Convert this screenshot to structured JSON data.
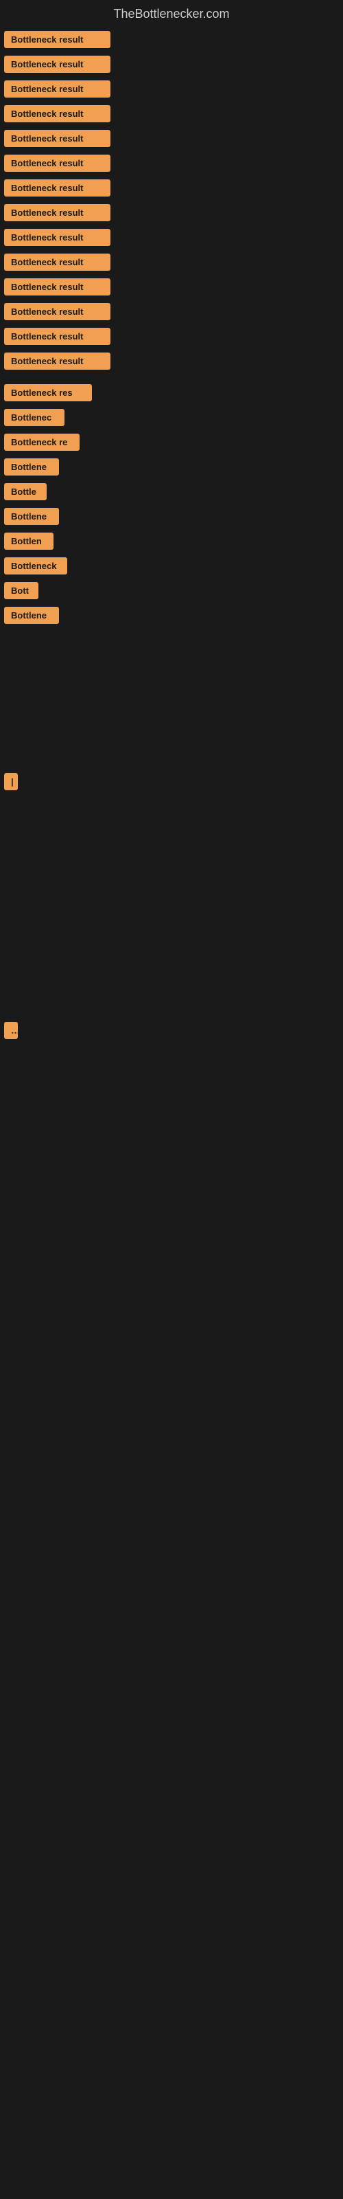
{
  "header": {
    "title": "TheBottlenecker.com"
  },
  "items": [
    {
      "label": "Bottleneck result",
      "width": 155
    },
    {
      "label": "Bottleneck result",
      "width": 155
    },
    {
      "label": "Bottleneck result",
      "width": 155
    },
    {
      "label": "Bottleneck result",
      "width": 155
    },
    {
      "label": "Bottleneck result",
      "width": 155
    },
    {
      "label": "Bottleneck result",
      "width": 155
    },
    {
      "label": "Bottleneck result",
      "width": 155
    },
    {
      "label": "Bottleneck result",
      "width": 155
    },
    {
      "label": "Bottleneck result",
      "width": 155
    },
    {
      "label": "Bottleneck result",
      "width": 155
    },
    {
      "label": "Bottleneck result",
      "width": 155
    },
    {
      "label": "Bottleneck result",
      "width": 155
    },
    {
      "label": "Bottleneck result",
      "width": 155
    },
    {
      "label": "Bottleneck result",
      "width": 155
    },
    {
      "label": "Bottleneck res",
      "width": 128
    },
    {
      "label": "Bottlenec",
      "width": 88
    },
    {
      "label": "Bottleneck re",
      "width": 110
    },
    {
      "label": "Bottlene",
      "width": 80
    },
    {
      "label": "Bottle",
      "width": 62
    },
    {
      "label": "Bottlene",
      "width": 80
    },
    {
      "label": "Bottlen",
      "width": 72
    },
    {
      "label": "Bottleneck",
      "width": 92
    },
    {
      "label": "Bott",
      "width": 50
    },
    {
      "label": "Bottlene",
      "width": 80
    }
  ],
  "trailing_items": [
    {
      "label": "|",
      "width": 10
    },
    {
      "label": "",
      "width": 0
    },
    {
      "label": "",
      "width": 0
    },
    {
      "label": "…",
      "width": 14
    }
  ]
}
